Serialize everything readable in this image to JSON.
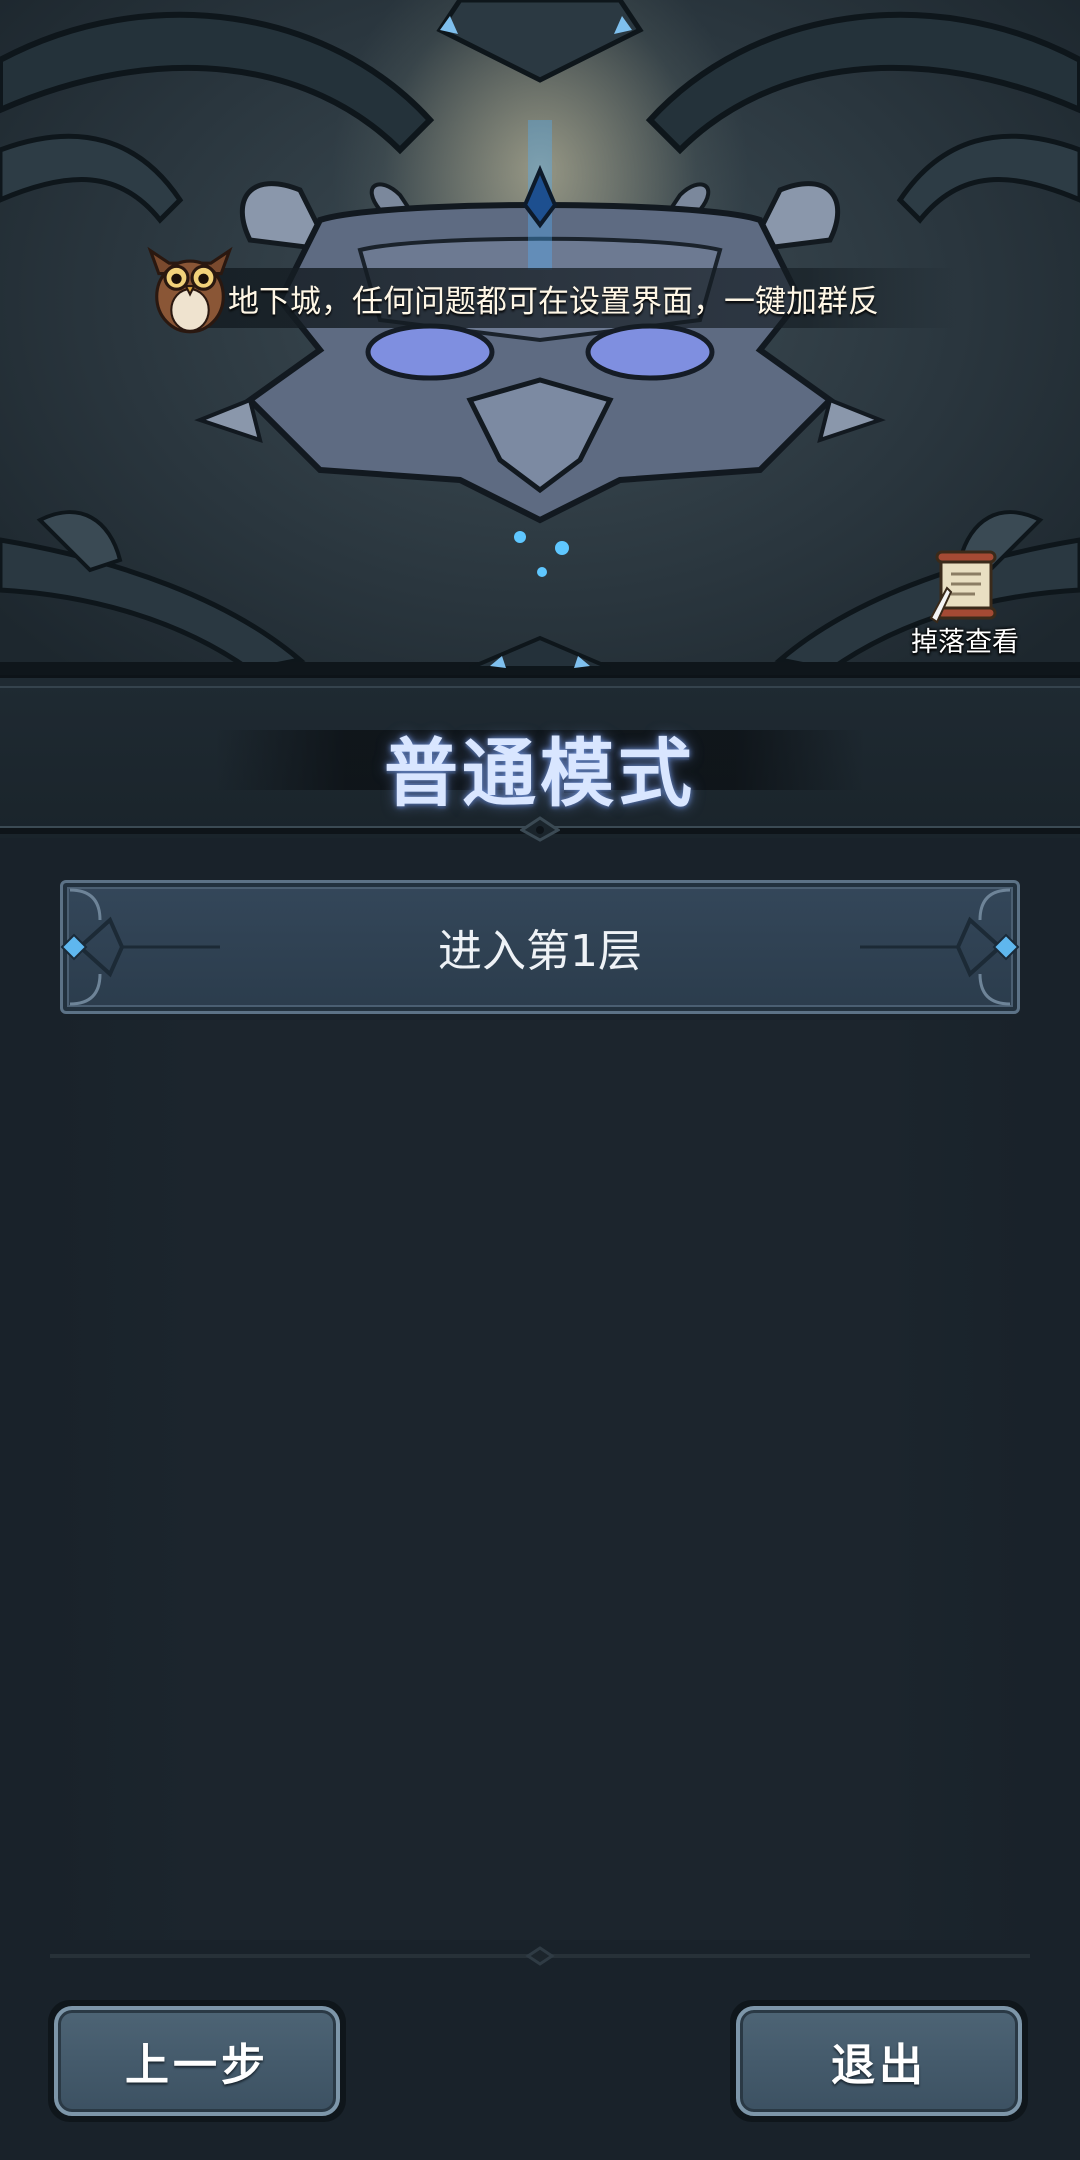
{
  "hero": {
    "tip_text": "地下城，任何问题都可在设置界面，一键加群反",
    "drops_label": "掉落查看"
  },
  "mode": {
    "title": "普通模式"
  },
  "floor_list": [
    {
      "label": "进入第1层"
    }
  ],
  "footer": {
    "back_label": "上一步",
    "exit_label": "退出"
  }
}
